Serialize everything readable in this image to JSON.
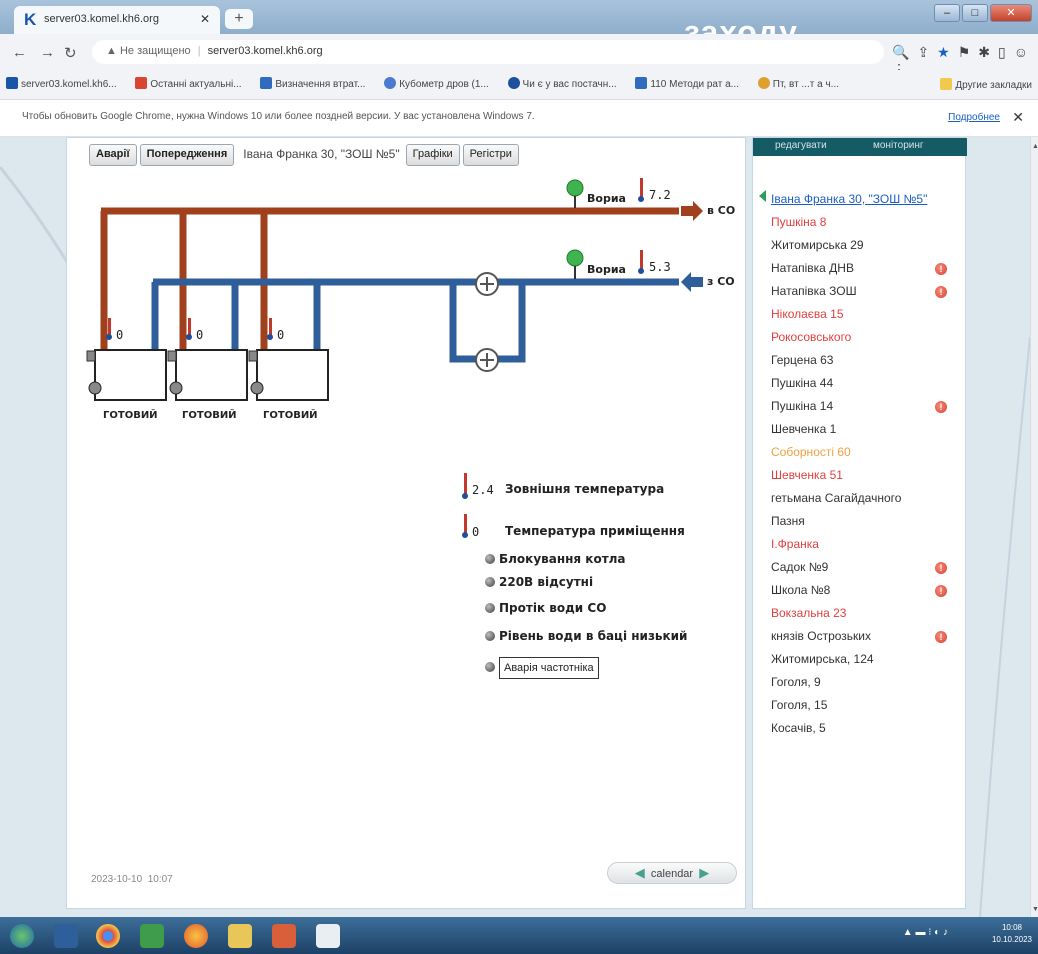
{
  "browser": {
    "tab_title": "server03.komel.kh6.org",
    "tab_icon_letter": "K",
    "overlay_text": "заходу",
    "address_warning": "Не защищено",
    "address_url": "server03.komel.kh6.org",
    "bookmarks": [
      "server03.komel.kh6...",
      "Останні актуальні...",
      "Визначення втрат...",
      "Кубометр дров (1...",
      "Чи є у вас постачн...",
      "110 Методи рат а...",
      "Пт, вт ...т а ч..."
    ],
    "bookmarks_right": "Другие закладки",
    "infobar_text": "Чтобы обновить Google Chrome, нужна Windows 10 или более поздней версии. У вас установлена Windows 7.",
    "infobar_more": "Подробнее"
  },
  "toolbar": {
    "alarms_label": "Аварії",
    "warnings_label": "Попередження",
    "object_name": "Івана Франка 30, \"ЗОШ №5\"",
    "graphs_label": "Графіки",
    "registers_label": "Регістри"
  },
  "scheme": {
    "supply_sensor_label": "Вориа",
    "supply_temp": "7.2",
    "supply_dir": "в СО",
    "return_sensor_label": "Вориа",
    "return_temp": "5.3",
    "return_dir": "з СО",
    "boilers": [
      {
        "temp": "0",
        "status": "ГОТОВИЙ"
      },
      {
        "temp": "0",
        "status": "ГОТОВИЙ"
      },
      {
        "temp": "0",
        "status": "ГОТОВИЙ"
      }
    ]
  },
  "legend": {
    "outdoor_temp": "2.4",
    "outdoor_label": "Зовнішня температура",
    "indoor_temp": "0",
    "indoor_label": "Температура приміщення",
    "items": [
      "Блокування котла",
      "220В відсутні",
      "Протік води СО",
      "Рівень води в баці низький"
    ],
    "alarm_box": "Аварія частотніка"
  },
  "footer": {
    "date": "2023-10-10",
    "time": "10:07",
    "calendar": "calendar"
  },
  "sidebar": {
    "tabs": [
      "редагувати",
      "моніторинг"
    ],
    "sites": [
      {
        "name": "Івана Франка 30, \"ЗОШ №5\"",
        "style": "link",
        "warn": false
      },
      {
        "name": "Пушкіна 8",
        "style": "red",
        "warn": false
      },
      {
        "name": "Житомирська 29",
        "style": "normal",
        "warn": false
      },
      {
        "name": "Натапівка ДНВ",
        "style": "normal",
        "warn": true
      },
      {
        "name": "Натапівка ЗОШ",
        "style": "normal",
        "warn": true
      },
      {
        "name": "Ніколаєва 15",
        "style": "red",
        "warn": false
      },
      {
        "name": "Рокосовського",
        "style": "red",
        "warn": false
      },
      {
        "name": "Герцена 63",
        "style": "normal",
        "warn": false
      },
      {
        "name": "Пушкіна 44",
        "style": "normal",
        "warn": false
      },
      {
        "name": "Пушкіна 14",
        "style": "normal",
        "warn": true
      },
      {
        "name": "Шевченка 1",
        "style": "normal",
        "warn": false
      },
      {
        "name": "Соборності 60",
        "style": "orange",
        "warn": false
      },
      {
        "name": "Шевченка 51",
        "style": "red",
        "warn": false
      },
      {
        "name": "гетьмана Сагайдачного",
        "style": "normal",
        "warn": false
      },
      {
        "name": "Пазня",
        "style": "normal",
        "warn": false
      },
      {
        "name": "І.Франка",
        "style": "red",
        "warn": false
      },
      {
        "name": "Садок №9",
        "style": "normal",
        "warn": true
      },
      {
        "name": "Школа №8",
        "style": "normal",
        "warn": true
      },
      {
        "name": "Вокзальна 23",
        "style": "red",
        "warn": false
      },
      {
        "name": "князів Острозьких",
        "style": "normal",
        "warn": true
      },
      {
        "name": "Житомирська, 124",
        "style": "normal",
        "warn": false
      },
      {
        "name": "Гоголя, 9",
        "style": "normal",
        "warn": false
      },
      {
        "name": "Гоголя, 15",
        "style": "normal",
        "warn": false
      },
      {
        "name": "Косачів, 5",
        "style": "normal",
        "warn": false
      }
    ]
  },
  "taskbar": {
    "clock_time": "10:08",
    "clock_date": "10.10.2023"
  },
  "colors": {
    "supply_pipe": "#a0401c",
    "return_pipe": "#2f5f9a",
    "warn_dot": "#d7402e"
  }
}
